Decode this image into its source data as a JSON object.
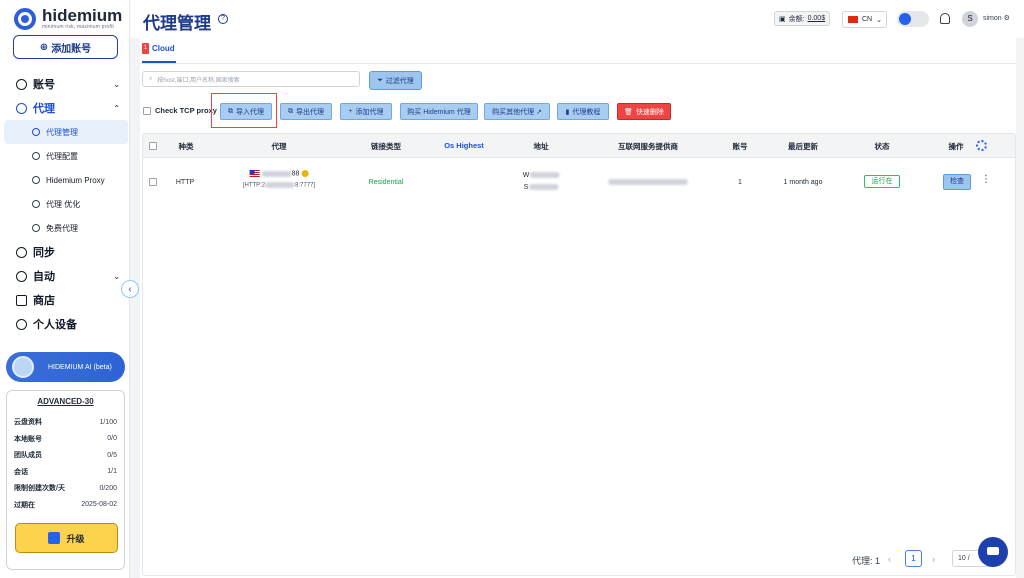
{
  "brand": {
    "name": "hidemium",
    "tagline": "minimum risk, maximum profit"
  },
  "sidebar": {
    "add_account": "添加账号",
    "items": [
      {
        "label": "账号"
      },
      {
        "label": "代理"
      },
      {
        "label": "同步"
      },
      {
        "label": "自动"
      },
      {
        "label": "商店"
      },
      {
        "label": "个人设备"
      }
    ],
    "sub_items": [
      {
        "label": "代理管理"
      },
      {
        "label": "代理配置"
      },
      {
        "label": "Hidemium Proxy"
      },
      {
        "label": "代理 优化"
      },
      {
        "label": "免费代理"
      }
    ],
    "ai_label": "HIDEMIUM AI (beta)",
    "plan": {
      "name": "ADVANCED-30",
      "rows": [
        {
          "label": "云盘资料",
          "value": "1/100"
        },
        {
          "label": "本地账号",
          "value": "0/0"
        },
        {
          "label": "团队成员",
          "value": "0/5"
        },
        {
          "label": "会话",
          "value": "1/1"
        },
        {
          "label": "限制创建次数/天",
          "value": "0/200"
        },
        {
          "label": "过期在",
          "value": "2025-08-02"
        }
      ],
      "upgrade": "升级"
    }
  },
  "header": {
    "title": "代理管理",
    "balance_label": "余额:",
    "balance_value": "0.00$",
    "lang": "CN",
    "user": "simon",
    "avatar": "S"
  },
  "tabs": [
    {
      "badge": "1",
      "label": "Cloud"
    }
  ],
  "search": {
    "placeholder": "按host,端口,用户名称,国家搜索"
  },
  "filter_label": "过滤代理",
  "tcp_label": "Check TCP proxy",
  "actions": {
    "import": "导入代理",
    "export": "导出代理",
    "add": "添加代理",
    "buy_hidemium": "购买 Hidemium 代理",
    "buy_other": "购买其他代理 ↗",
    "tutorial": "代理教程",
    "quick_delete": "快速删除"
  },
  "table": {
    "headers": [
      "种类",
      "代理",
      "链接类型",
      "Os Highest",
      "地址",
      "互联网服务提供商",
      "账号",
      "最后更新",
      "状态",
      "操作"
    ],
    "rows": [
      {
        "type": "HTTP",
        "proxy_line1": "88",
        "proxy_line2": "[HTTP:2",
        "proxy_line2b": "8:7777]",
        "link_type": "Residential",
        "address_1": "W",
        "address_2": "S",
        "accounts": "1",
        "last_update": "1 month ago",
        "status": "运行在",
        "check": "检查"
      }
    ]
  },
  "pagination": {
    "label": "代理: 1",
    "page": "1",
    "size": "10 /"
  }
}
